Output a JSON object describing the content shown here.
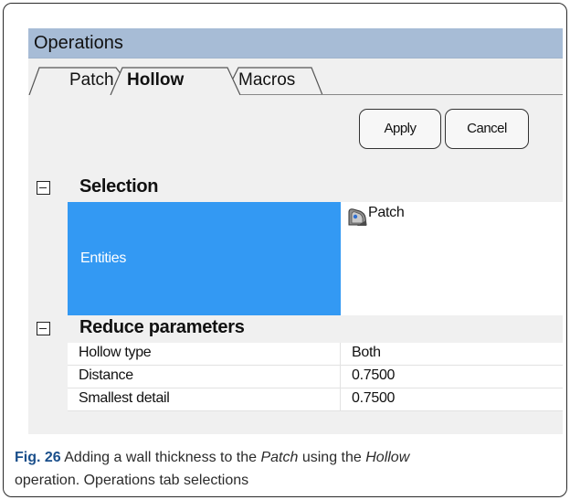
{
  "window": {
    "title": "Operations"
  },
  "tabs": [
    {
      "label": "Patch",
      "active": false
    },
    {
      "label": "Hollow",
      "active": true
    },
    {
      "label": "Macros",
      "active": false
    }
  ],
  "buttons": {
    "apply_label": "Apply",
    "cancel_label": "Cancel"
  },
  "selection": {
    "category": "Selection",
    "entities_label": "Entities",
    "entities_value": "Patch",
    "entities_icon": "patch-surface-icon"
  },
  "reduce": {
    "category": "Reduce parameters",
    "rows": [
      {
        "label": "Hollow type",
        "value": "Both"
      },
      {
        "label": "Distance",
        "value": "0.7500"
      },
      {
        "label": "Smallest detail",
        "value": "0.7500"
      }
    ]
  },
  "caption": {
    "fig_label": "Fig. 26",
    "text_1": " Adding a wall thickness to the ",
    "term_1": "Patch",
    "text_2": " using the ",
    "term_2": "Hollow",
    "text_3": "operation. Operations tab selections"
  },
  "colors": {
    "titlebar": "#a7bcd6",
    "selected_cell": "#3399f3",
    "caption_label": "#1a4f8b"
  }
}
